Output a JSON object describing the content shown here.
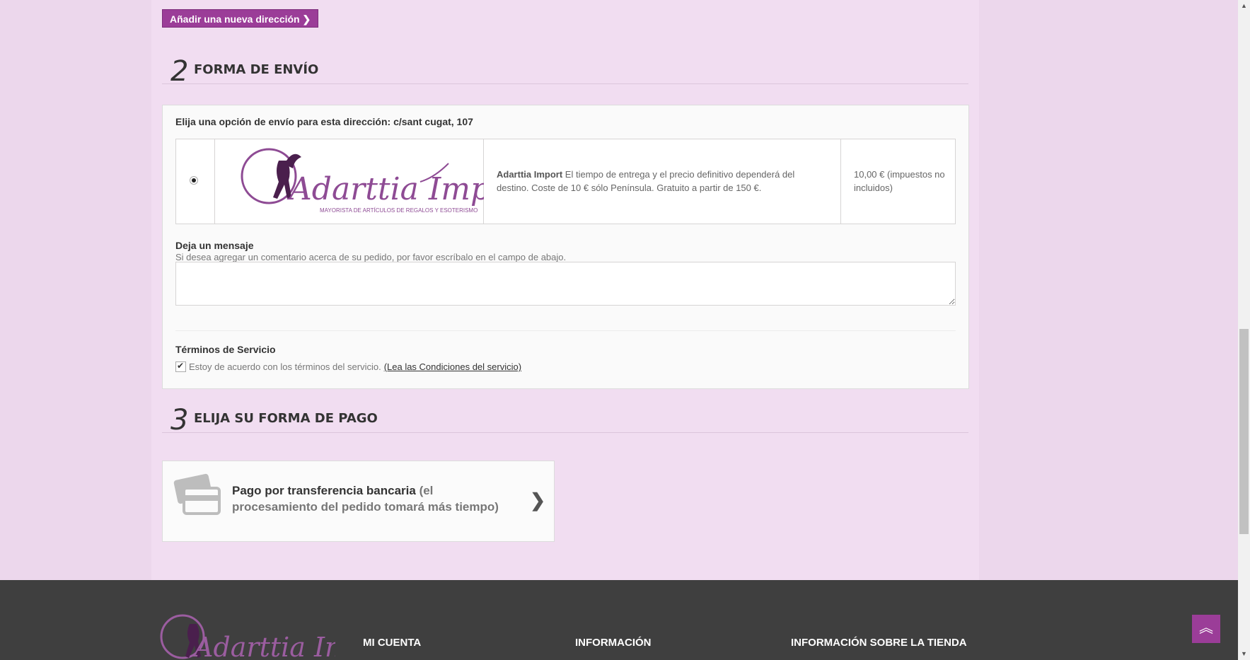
{
  "address": {
    "add_button_label": "Añadir una nueva dirección"
  },
  "step2": {
    "number": "2",
    "title": "FORMA DE ENVÍO"
  },
  "shipping": {
    "choose_text": "Elija una opción de envío para esta dirección: c/sant cugat, 107",
    "carrier_logo_text": "Adarttia Import",
    "carrier_logo_subtitle": "MAYORISTA DE ARTÍCULOS DE REGALOS Y ESOTERISMO",
    "carrier_name": "Adarttia Import",
    "carrier_desc": "El tiempo de entrega y el precio definitivo dependerá del destino. Coste de 10 € sólo Península. Gratuito a partir de 150 €.",
    "price": "10,00 € (impuestos no incluidos)"
  },
  "message": {
    "title": "Deja un mensaje",
    "help": "Si desea agregar un comentario acerca de su pedido, por favor escríbalo en el campo de abajo."
  },
  "terms": {
    "title": "Términos de Servicio",
    "agree_text": "Estoy de acuerdo con los términos del servicio.",
    "link_text": "(Lea las Condiciones del servicio)"
  },
  "step3": {
    "number": "3",
    "title": "ELIJA SU FORMA DE PAGO"
  },
  "payment": {
    "method": "Pago por transferencia bancaria",
    "note": "(el procesamiento del pedido tomará más tiempo)"
  },
  "footer": {
    "logo_text": "Adarttia Import",
    "col1": "MI CUENTA",
    "col2": "INFORMACIÓN",
    "col3": "INFORMACIÓN SOBRE LA TIENDA"
  },
  "colors": {
    "accent": "#9b3d98",
    "background": "#f1ddf1",
    "footer": "#3f3f3f"
  }
}
